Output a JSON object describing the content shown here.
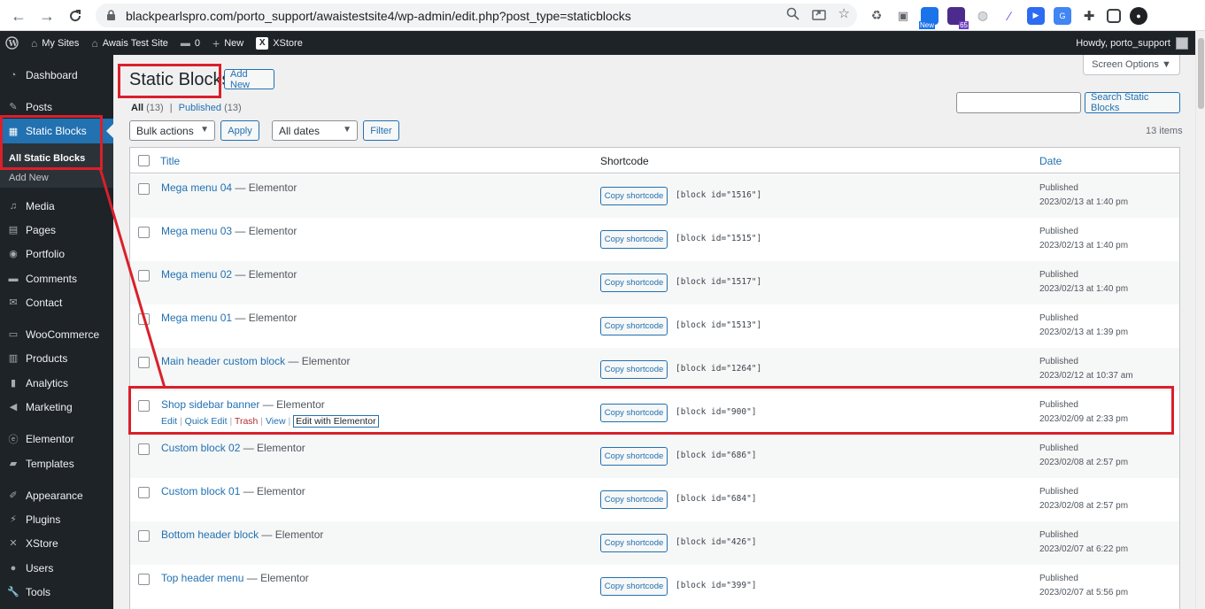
{
  "browser": {
    "url": "blackpearlspro.com/porto_support/awaistestsite4/wp-admin/edit.php?post_type=staticblocks",
    "ext_badge_new": "New",
    "ext_badge_65": "65"
  },
  "adminbar": {
    "my_sites": "My Sites",
    "site_name": "Awais Test Site",
    "comments_count": "0",
    "new": "New",
    "xstore": "XStore",
    "howdy": "Howdy, porto_support"
  },
  "sidebar": {
    "items": [
      {
        "label": "Dashboard",
        "icon": "dashboard-icon"
      },
      {
        "label": "Posts",
        "icon": "pin-icon"
      },
      {
        "label": "Static Blocks",
        "icon": "table-icon"
      },
      {
        "label": "Media",
        "icon": "media-icon"
      },
      {
        "label": "Pages",
        "icon": "page-icon"
      },
      {
        "label": "Portfolio",
        "icon": "portfolio-icon"
      },
      {
        "label": "Comments",
        "icon": "comment-icon"
      },
      {
        "label": "Contact",
        "icon": "mail-icon"
      },
      {
        "label": "WooCommerce",
        "icon": "woo-icon"
      },
      {
        "label": "Products",
        "icon": "archive-icon"
      },
      {
        "label": "Analytics",
        "icon": "chart-icon"
      },
      {
        "label": "Marketing",
        "icon": "megaphone-icon"
      },
      {
        "label": "Elementor",
        "icon": "elementor-icon"
      },
      {
        "label": "Templates",
        "icon": "folder-icon"
      },
      {
        "label": "Appearance",
        "icon": "brush-icon"
      },
      {
        "label": "Plugins",
        "icon": "plugin-icon"
      },
      {
        "label": "XStore",
        "icon": "xstore-icon"
      },
      {
        "label": "Users",
        "icon": "user-icon"
      },
      {
        "label": "Tools",
        "icon": "wrench-icon"
      }
    ],
    "submenu": {
      "all": "All Static Blocks",
      "add": "Add New"
    }
  },
  "page": {
    "title": "Static Blocks",
    "add_new": "Add New",
    "screen_options": "Screen Options ▼",
    "filter_all": "All",
    "filter_all_count": "(13)",
    "filter_sep": "|",
    "filter_published": "Published",
    "filter_published_count": "(13)",
    "search_button": "Search Static Blocks",
    "bulk_actions": "Bulk actions",
    "apply": "Apply",
    "all_dates": "All dates",
    "filter": "Filter",
    "items_count": "13 items"
  },
  "table": {
    "headers": {
      "title": "Title",
      "shortcode": "Shortcode",
      "date": "Date"
    },
    "copy_label": "Copy shortcode",
    "dash_suffix": "— Elementor",
    "row_actions": {
      "edit": "Edit",
      "quick_edit": "Quick Edit",
      "trash": "Trash",
      "view": "View",
      "edit_elementor": "Edit with Elementor",
      "sep": "|"
    },
    "rows": [
      {
        "title": "Mega menu 04",
        "code": "[block id=\"1516\"]",
        "status": "Published",
        "date": "2023/02/13 at 1:40 pm"
      },
      {
        "title": "Mega menu 03",
        "code": "[block id=\"1515\"]",
        "status": "Published",
        "date": "2023/02/13 at 1:40 pm"
      },
      {
        "title": "Mega menu 02",
        "code": "[block id=\"1517\"]",
        "status": "Published",
        "date": "2023/02/13 at 1:40 pm"
      },
      {
        "title": "Mega menu 01",
        "code": "[block id=\"1513\"]",
        "status": "Published",
        "date": "2023/02/13 at 1:39 pm"
      },
      {
        "title": "Main header custom block",
        "code": "[block id=\"1264\"]",
        "status": "Published",
        "date": "2023/02/12 at 10:37 am"
      },
      {
        "title": "Shop sidebar banner",
        "code": "[block id=\"900\"]",
        "status": "Published",
        "date": "2023/02/09 at 2:33 pm"
      },
      {
        "title": "Custom block 02",
        "code": "[block id=\"686\"]",
        "status": "Published",
        "date": "2023/02/08 at 2:57 pm"
      },
      {
        "title": "Custom block 01",
        "code": "[block id=\"684\"]",
        "status": "Published",
        "date": "2023/02/08 at 2:57 pm"
      },
      {
        "title": "Bottom header block",
        "code": "[block id=\"426\"]",
        "status": "Published",
        "date": "2023/02/07 at 6:22 pm"
      },
      {
        "title": "Top header menu",
        "code": "[block id=\"399\"]",
        "status": "Published",
        "date": "2023/02/07 at 5:56 pm"
      }
    ]
  }
}
